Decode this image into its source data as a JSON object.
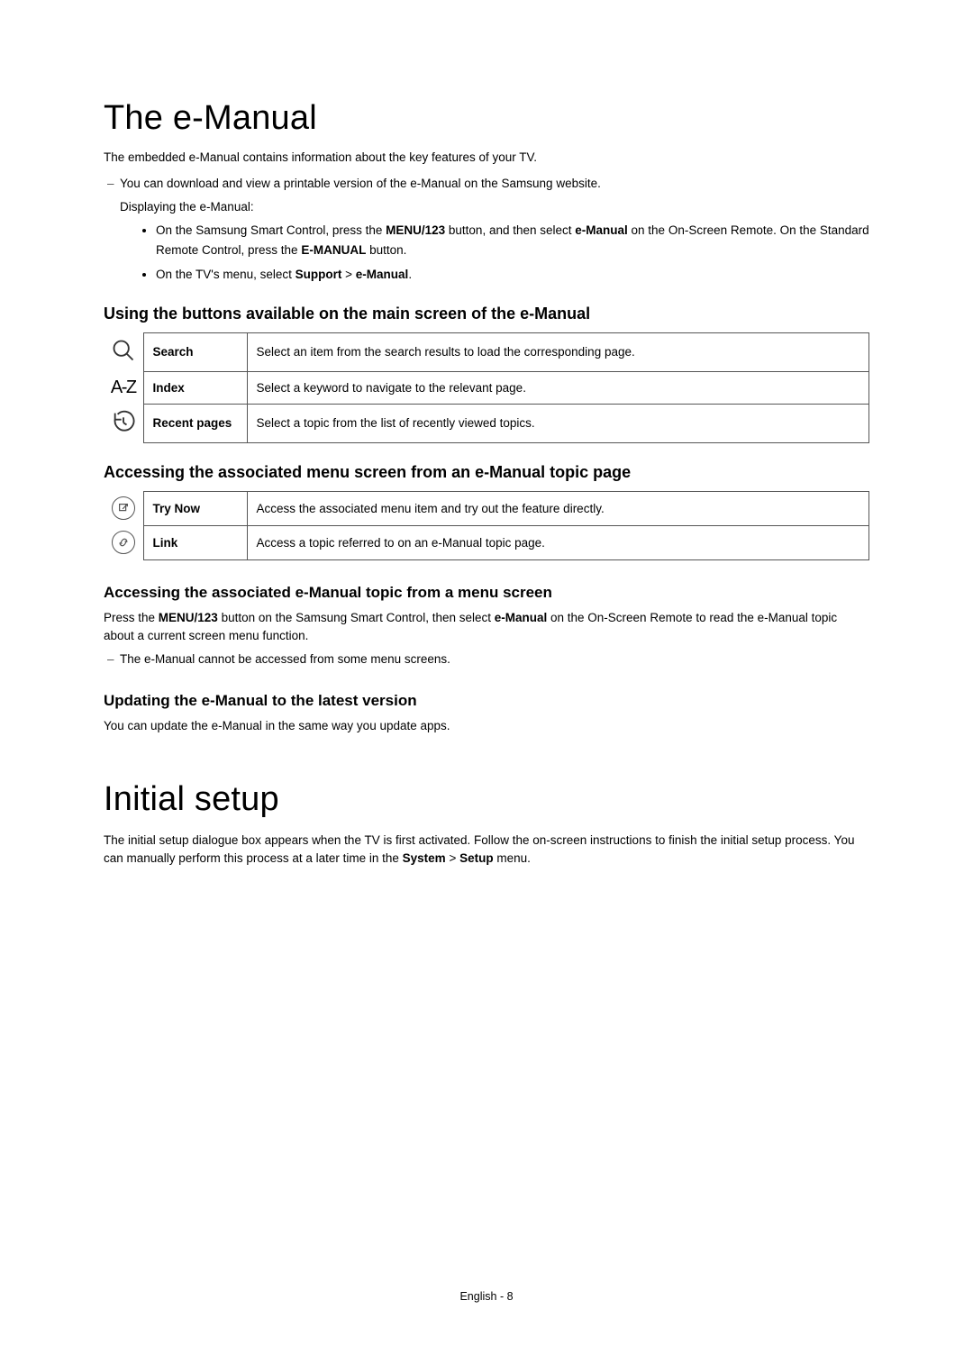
{
  "section1": {
    "title": "The e-Manual",
    "intro": "The embedded e-Manual contains information about the key features of your TV.",
    "download_note": "You can download and view a printable version of the e-Manual on the Samsung website.",
    "displaying_label": "Displaying the e-Manual:",
    "bullet1_a": "On the Samsung Smart Control, press the ",
    "bullet1_btn1": "MENU/123",
    "bullet1_b": " button, and then select ",
    "bullet1_btn2": "e-Manual",
    "bullet1_c": " on the On-Screen Remote. On the Standard Remote Control, press the ",
    "bullet1_btn3": "E-MANUAL",
    "bullet1_d": " button.",
    "bullet2_a": "On the TV's menu, select ",
    "bullet2_b": "Support",
    "bullet2_gt": " > ",
    "bullet2_c": "e-Manual",
    "bullet2_d": ".",
    "sub1": "Using the buttons available on the main screen of the e-Manual",
    "table1": [
      {
        "icon": "search-icon",
        "label": "Search",
        "desc": "Select an item from the search results to load the corresponding page."
      },
      {
        "icon": "az-icon",
        "label": "Index",
        "desc": "Select a keyword to navigate to the relevant page."
      },
      {
        "icon": "recent-icon",
        "label": "Recent pages",
        "desc": "Select a topic from the list of recently viewed topics."
      }
    ],
    "sub2": "Accessing the associated menu screen from an e-Manual topic page",
    "table2": [
      {
        "icon": "trynow-icon",
        "label": "Try Now",
        "desc": "Access the associated menu item and try out the feature directly."
      },
      {
        "icon": "link-icon",
        "label": "Link",
        "desc": "Access a topic referred to on an e-Manual topic page."
      }
    ],
    "sub3": "Accessing the associated e-Manual topic from a menu screen",
    "sub3_p_a": "Press the ",
    "sub3_p_b": "MENU/123",
    "sub3_p_c": " button on the Samsung Smart Control, then select ",
    "sub3_p_d": "e-Manual",
    "sub3_p_e": " on the On-Screen Remote to read the e-Manual topic about a current screen menu function.",
    "sub3_note": "The e-Manual cannot be accessed from some menu screens.",
    "sub4": "Updating the e-Manual to the latest version",
    "sub4_p": "You can update the e-Manual in the same way you update apps."
  },
  "section2": {
    "title": "Initial setup",
    "p_a": "The initial setup dialogue box appears when the TV is first activated. Follow the on-screen instructions to finish the initial setup process. You can manually perform this process at a later time in the ",
    "p_b": "System",
    "p_gt": " > ",
    "p_c": "Setup",
    "p_d": " menu."
  },
  "footer": "English - 8"
}
